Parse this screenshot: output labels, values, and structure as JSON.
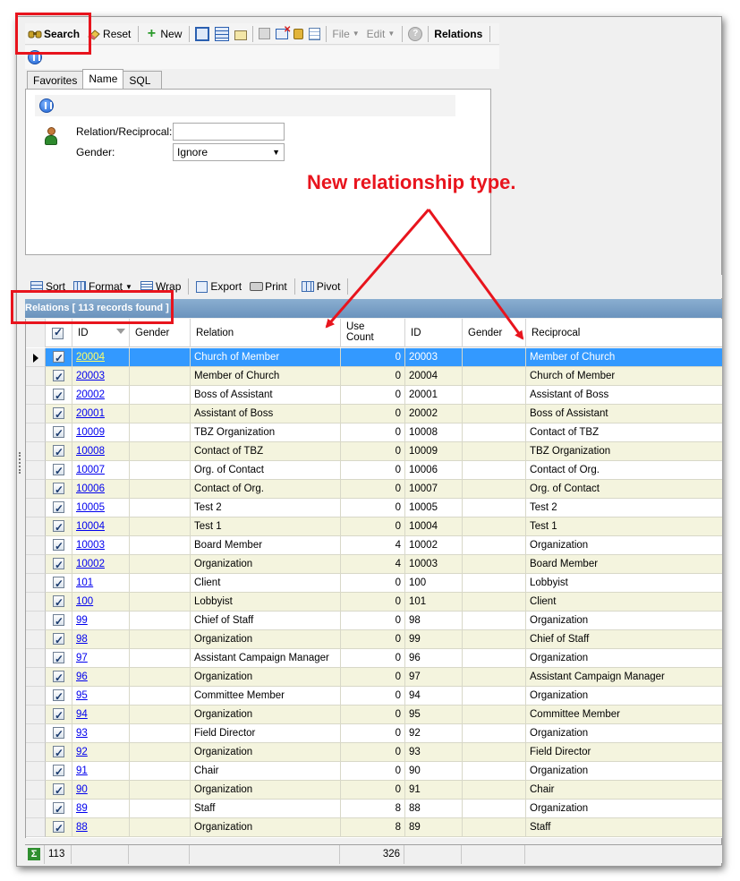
{
  "toolbar": {
    "search": "Search",
    "reset": "Reset",
    "new": "New",
    "file": "File",
    "edit": "Edit",
    "relations": "Relations"
  },
  "tabs": [
    "Favorites",
    "Name",
    "SQL"
  ],
  "form": {
    "relation_label": "Relation/Reciprocal:",
    "relation_value": "",
    "gender_label": "Gender:",
    "gender_value": "Ignore"
  },
  "annotation": "New relationship type.",
  "grid_toolbar": {
    "sort": "Sort",
    "format": "Format",
    "wrap": "Wrap",
    "export": "Export",
    "print": "Print",
    "pivot": "Pivot"
  },
  "caption": "Relations [ 113 records found ]",
  "columns": {
    "id": "ID",
    "gender": "Gender",
    "relation": "Relation",
    "use_count": "Use Count",
    "id2": "ID",
    "gender2": "Gender",
    "reciprocal": "Reciprocal"
  },
  "rows": [
    {
      "id": "20004",
      "relation": "Church of Member",
      "use": "0",
      "id2": "20003",
      "recip": "Member of Church"
    },
    {
      "id": "20003",
      "relation": "Member of Church",
      "use": "0",
      "id2": "20004",
      "recip": "Church of Member"
    },
    {
      "id": "20002",
      "relation": "Boss of Assistant",
      "use": "0",
      "id2": "20001",
      "recip": "Assistant of Boss"
    },
    {
      "id": "20001",
      "relation": "Assistant of Boss",
      "use": "0",
      "id2": "20002",
      "recip": "Boss of Assistant"
    },
    {
      "id": "10009",
      "relation": "TBZ Organization",
      "use": "0",
      "id2": "10008",
      "recip": "Contact of TBZ"
    },
    {
      "id": "10008",
      "relation": "Contact of TBZ",
      "use": "0",
      "id2": "10009",
      "recip": "TBZ Organization"
    },
    {
      "id": "10007",
      "relation": "Org. of Contact",
      "use": "0",
      "id2": "10006",
      "recip": "Contact of Org."
    },
    {
      "id": "10006",
      "relation": "Contact of Org.",
      "use": "0",
      "id2": "10007",
      "recip": "Org. of Contact"
    },
    {
      "id": "10005",
      "relation": "Test 2",
      "use": "0",
      "id2": "10005",
      "recip": "Test 2"
    },
    {
      "id": "10004",
      "relation": "Test 1",
      "use": "0",
      "id2": "10004",
      "recip": "Test 1"
    },
    {
      "id": "10003",
      "relation": "Board Member",
      "use": "4",
      "id2": "10002",
      "recip": "Organization"
    },
    {
      "id": "10002",
      "relation": "Organization",
      "use": "4",
      "id2": "10003",
      "recip": "Board Member"
    },
    {
      "id": "101",
      "relation": "Client",
      "use": "0",
      "id2": "100",
      "recip": "Lobbyist"
    },
    {
      "id": "100",
      "relation": "Lobbyist",
      "use": "0",
      "id2": "101",
      "recip": "Client"
    },
    {
      "id": "99",
      "relation": "Chief of Staff",
      "use": "0",
      "id2": "98",
      "recip": "Organization"
    },
    {
      "id": "98",
      "relation": "Organization",
      "use": "0",
      "id2": "99",
      "recip": "Chief of Staff"
    },
    {
      "id": "97",
      "relation": "Assistant Campaign Manager",
      "use": "0",
      "id2": "96",
      "recip": "Organization"
    },
    {
      "id": "96",
      "relation": "Organization",
      "use": "0",
      "id2": "97",
      "recip": "Assistant Campaign Manager"
    },
    {
      "id": "95",
      "relation": "Committee Member",
      "use": "0",
      "id2": "94",
      "recip": "Organization"
    },
    {
      "id": "94",
      "relation": "Organization",
      "use": "0",
      "id2": "95",
      "recip": "Committee Member"
    },
    {
      "id": "93",
      "relation": "Field Director",
      "use": "0",
      "id2": "92",
      "recip": "Organization"
    },
    {
      "id": "92",
      "relation": "Organization",
      "use": "0",
      "id2": "93",
      "recip": "Field Director"
    },
    {
      "id": "91",
      "relation": "Chair",
      "use": "0",
      "id2": "90",
      "recip": "Organization"
    },
    {
      "id": "90",
      "relation": "Organization",
      "use": "0",
      "id2": "91",
      "recip": "Chair"
    },
    {
      "id": "89",
      "relation": "Staff",
      "use": "8",
      "id2": "88",
      "recip": "Organization"
    },
    {
      "id": "88",
      "relation": "Organization",
      "use": "8",
      "id2": "89",
      "recip": "Staff"
    }
  ],
  "footer": {
    "count": "113",
    "use_total": "326"
  },
  "colors": {
    "annotation_red": "#e8141d",
    "selected_row": "#3399ff",
    "alt_row": "#f4f4de",
    "caption_bar": "#6b93bd"
  }
}
